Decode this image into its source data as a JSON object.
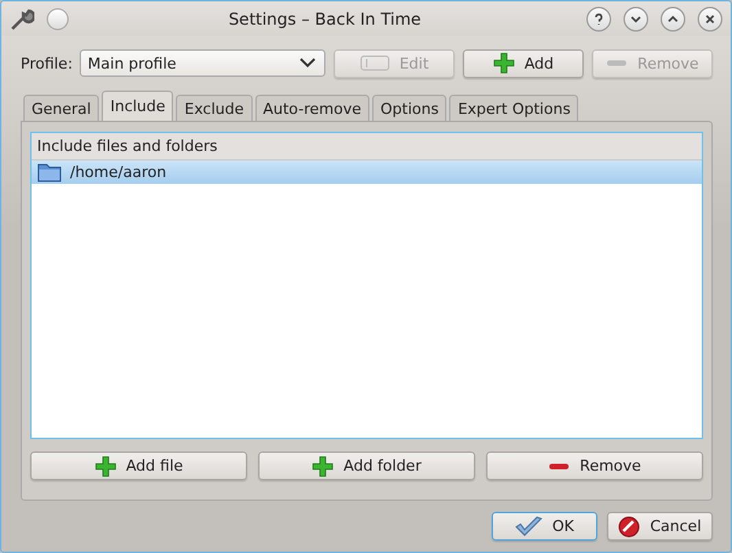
{
  "window": {
    "title": "Settings – Back In Time"
  },
  "profile": {
    "label": "Profile:",
    "value": "Main profile",
    "buttons": [
      {
        "label": "Edit",
        "kind": "edit",
        "disabled": true
      },
      {
        "label": "Add",
        "kind": "add",
        "disabled": false
      },
      {
        "label": "Remove",
        "kind": "remove",
        "disabled": true
      }
    ]
  },
  "tabs": [
    {
      "label": "General",
      "selected": false
    },
    {
      "label": "Include",
      "selected": true
    },
    {
      "label": "Exclude",
      "selected": false
    },
    {
      "label": "Auto-remove",
      "selected": false
    },
    {
      "label": "Options",
      "selected": false
    },
    {
      "label": "Expert Options",
      "selected": false
    }
  ],
  "list": {
    "header": "Include files and folders",
    "rows": [
      {
        "path": "/home/aaron",
        "selected": true
      }
    ]
  },
  "list_buttons": [
    {
      "label": "Add file",
      "kind": "add"
    },
    {
      "label": "Add folder",
      "kind": "add"
    },
    {
      "label": "Remove",
      "kind": "remove"
    }
  ],
  "dialog_buttons": [
    {
      "label": "OK",
      "kind": "ok"
    },
    {
      "label": "Cancel",
      "kind": "cancel"
    }
  ]
}
